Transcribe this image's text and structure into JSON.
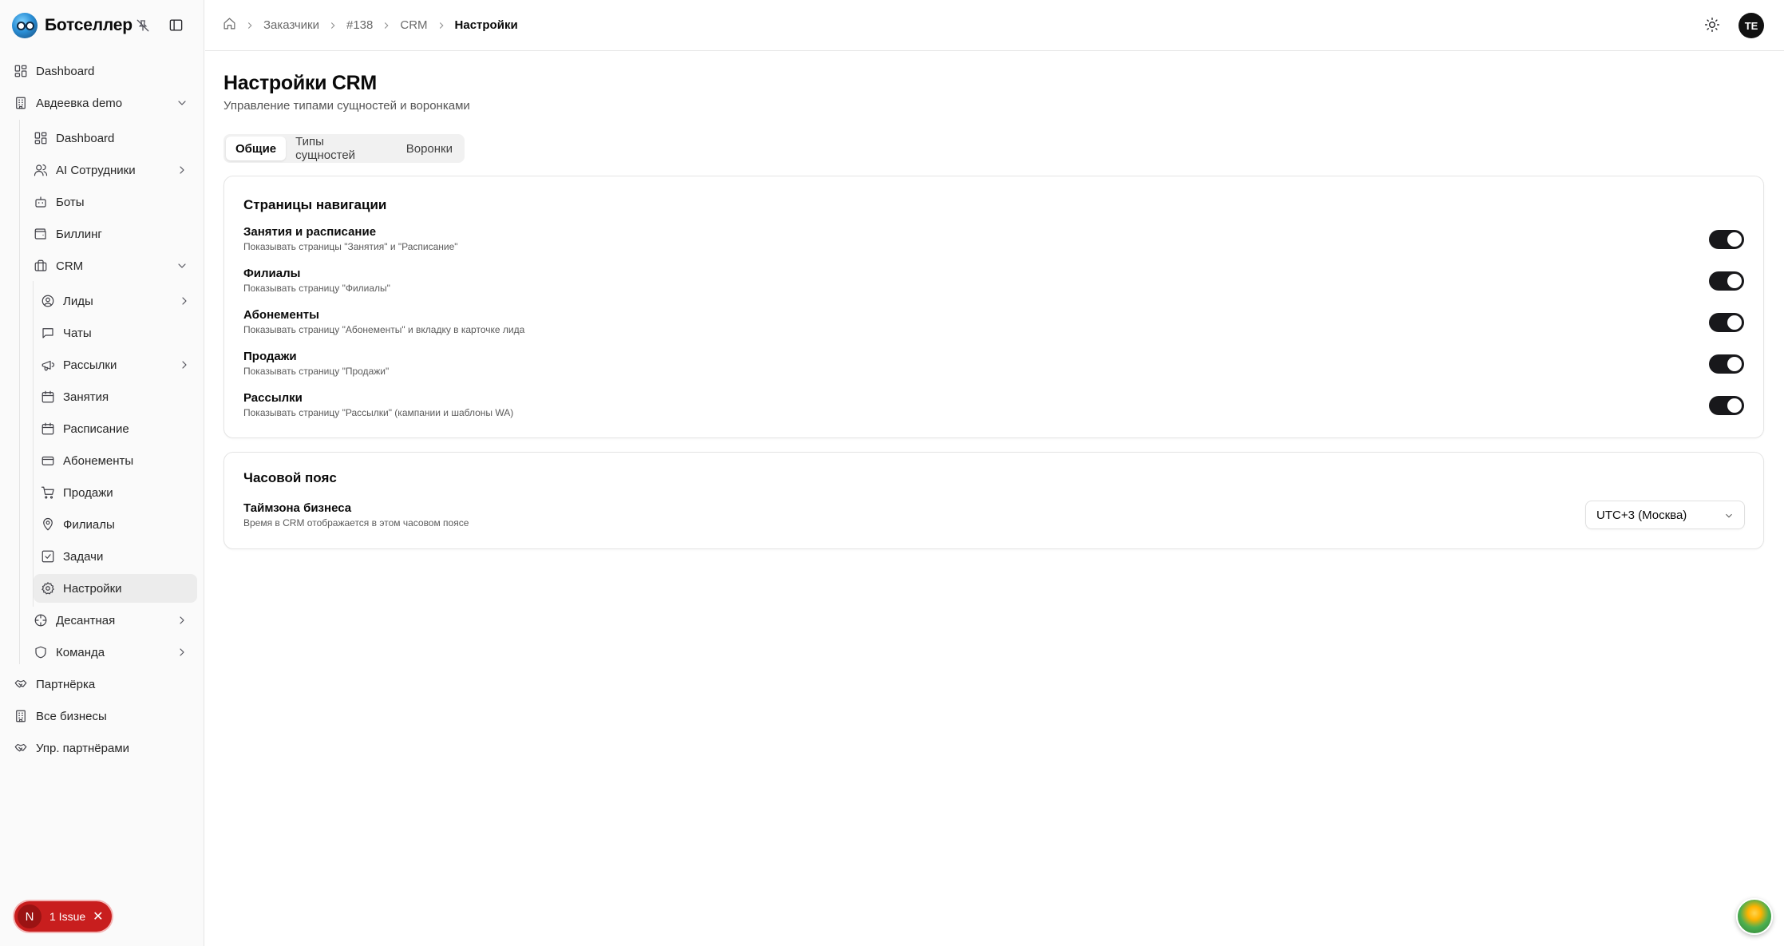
{
  "brand": {
    "name": "Ботселлер"
  },
  "sidebar": {
    "items": [
      {
        "label": "Dashboard",
        "icon": "dashboard-icon"
      },
      {
        "label": "Авдеевка demo",
        "icon": "building-icon",
        "expanded": true
      },
      {
        "label": "Dashboard",
        "icon": "dashboard-icon"
      },
      {
        "label": "AI Сотрудники",
        "icon": "users-icon"
      },
      {
        "label": "Боты",
        "icon": "bot-icon"
      },
      {
        "label": "Биллинг",
        "icon": "wallet-icon"
      },
      {
        "label": "CRM",
        "icon": "briefcase-icon",
        "expanded": true
      },
      {
        "label": "Лиды",
        "icon": "user-circle-icon"
      },
      {
        "label": "Чаты",
        "icon": "chat-icon"
      },
      {
        "label": "Рассылки",
        "icon": "megaphone-icon"
      },
      {
        "label": "Занятия",
        "icon": "calendar-icon"
      },
      {
        "label": "Расписание",
        "icon": "calendar-icon"
      },
      {
        "label": "Абонементы",
        "icon": "credit-card-icon"
      },
      {
        "label": "Продажи",
        "icon": "cart-icon"
      },
      {
        "label": "Филиалы",
        "icon": "map-pin-icon"
      },
      {
        "label": "Задачи",
        "icon": "check-square-icon"
      },
      {
        "label": "Настройки",
        "icon": "gear-icon",
        "active": true
      },
      {
        "label": "Десантная",
        "icon": "crosshair-icon"
      },
      {
        "label": "Команда",
        "icon": "shield-icon"
      },
      {
        "label": "Партнёрка",
        "icon": "handshake-icon"
      },
      {
        "label": "Все бизнесы",
        "icon": "building-icon"
      },
      {
        "label": "Упр. партнёрами",
        "icon": "handshake-icon"
      }
    ]
  },
  "issues": {
    "badge": "N",
    "label": "1 Issue",
    "close": "✕"
  },
  "header": {
    "breadcrumbs": [
      "Заказчики",
      "#138",
      "CRM",
      "Настройки"
    ],
    "avatar": "TE"
  },
  "page": {
    "title": "Настройки CRM",
    "subtitle": "Управление типами сущностей и воронками",
    "tabs": [
      {
        "label": "Общие",
        "active": true
      },
      {
        "label": "Типы сущностей"
      },
      {
        "label": "Воронки"
      }
    ]
  },
  "nav_pages": {
    "title": "Страницы навигации",
    "settings": [
      {
        "title": "Занятия и расписание",
        "desc": "Показывать страницы \"Занятия\" и \"Расписание\"",
        "enabled": true
      },
      {
        "title": "Филиалы",
        "desc": "Показывать страницу \"Филиалы\"",
        "enabled": true
      },
      {
        "title": "Абонементы",
        "desc": "Показывать страницу \"Абонементы\" и вкладку в карточке лида",
        "enabled": true
      },
      {
        "title": "Продажи",
        "desc": "Показывать страницу \"Продажи\"",
        "enabled": true
      },
      {
        "title": "Рассылки",
        "desc": "Показывать страницу \"Рассылки\" (кампании и шаблоны WA)",
        "enabled": true
      }
    ]
  },
  "timezone": {
    "title": "Часовой пояс",
    "setting_title": "Таймзона бизнеса",
    "setting_desc": "Время в CRM отображается в этом часовом поясе",
    "selected": "UTC+3 (Москва)"
  },
  "colors": {
    "toggle_on": "#18181b",
    "issue": "#c81e1e",
    "active_nav": "#ececec"
  }
}
